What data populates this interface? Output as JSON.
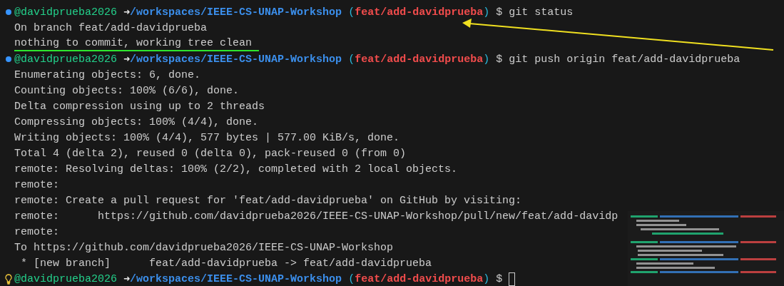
{
  "terminal": {
    "lines": [
      {
        "kind": "prompt",
        "lightbulb": false,
        "user": "@davidprueba2026",
        "arrow": "➜",
        "path": "/workspaces/IEEE-CS-UNAP-Workshop",
        "paren_open": "(",
        "branch": "feat/add-davidprueba",
        "paren_close": ")",
        "symbol": "$",
        "command": "git status",
        "pointed": true
      },
      {
        "kind": "output",
        "text": "On branch feat/add-davidprueba",
        "underlined": false
      },
      {
        "kind": "output",
        "text": "nothing to commit, working tree clean",
        "underlined": true
      },
      {
        "kind": "prompt",
        "lightbulb": false,
        "user": "@davidprueba2026",
        "arrow": "➜",
        "path": "/workspaces/IEEE-CS-UNAP-Workshop",
        "paren_open": "(",
        "branch": "feat/add-davidprueba",
        "paren_close": ")",
        "symbol": "$",
        "command": "git push origin feat/add-davidprueba"
      },
      {
        "kind": "output",
        "text": "Enumerating objects: 6, done.",
        "underlined": false
      },
      {
        "kind": "output",
        "text": "Counting objects: 100% (6/6), done.",
        "underlined": false
      },
      {
        "kind": "output",
        "text": "Delta compression using up to 2 threads",
        "underlined": false
      },
      {
        "kind": "output",
        "text": "Compressing objects: 100% (4/4), done.",
        "underlined": false
      },
      {
        "kind": "output",
        "text": "Writing objects: 100% (4/4), 577 bytes | 577.00 KiB/s, done.",
        "underlined": false
      },
      {
        "kind": "output",
        "text": "Total 4 (delta 2), reused 0 (delta 0), pack-reused 0 (from 0)",
        "underlined": false
      },
      {
        "kind": "output",
        "text": "remote: Resolving deltas: 100% (2/2), completed with 2 local objects.",
        "underlined": false
      },
      {
        "kind": "output",
        "text": "remote:",
        "underlined": false
      },
      {
        "kind": "output",
        "text": "remote: Create a pull request for 'feat/add-davidprueba' on GitHub by visiting:",
        "underlined": false
      },
      {
        "kind": "output",
        "text": "remote:      https://github.com/davidprueba2026/IEEE-CS-UNAP-Workshop/pull/new/feat/add-davidp",
        "underlined": false
      },
      {
        "kind": "output",
        "text": "remote:",
        "underlined": false
      },
      {
        "kind": "output",
        "text": "To https://github.com/davidprueba2026/IEEE-CS-UNAP-Workshop",
        "underlined": false
      },
      {
        "kind": "output",
        "text": " * [new branch]      feat/add-davidprueba -> feat/add-davidprueba",
        "underlined": false
      },
      {
        "kind": "prompt",
        "lightbulb": true,
        "user": "@davidprueba2026",
        "arrow": "➜",
        "path": "/workspaces/IEEE-CS-UNAP-Workshop",
        "paren_open": "(",
        "branch": "feat/add-davidprueba",
        "paren_close": ")",
        "symbol": "$",
        "cursor": true
      }
    ]
  }
}
